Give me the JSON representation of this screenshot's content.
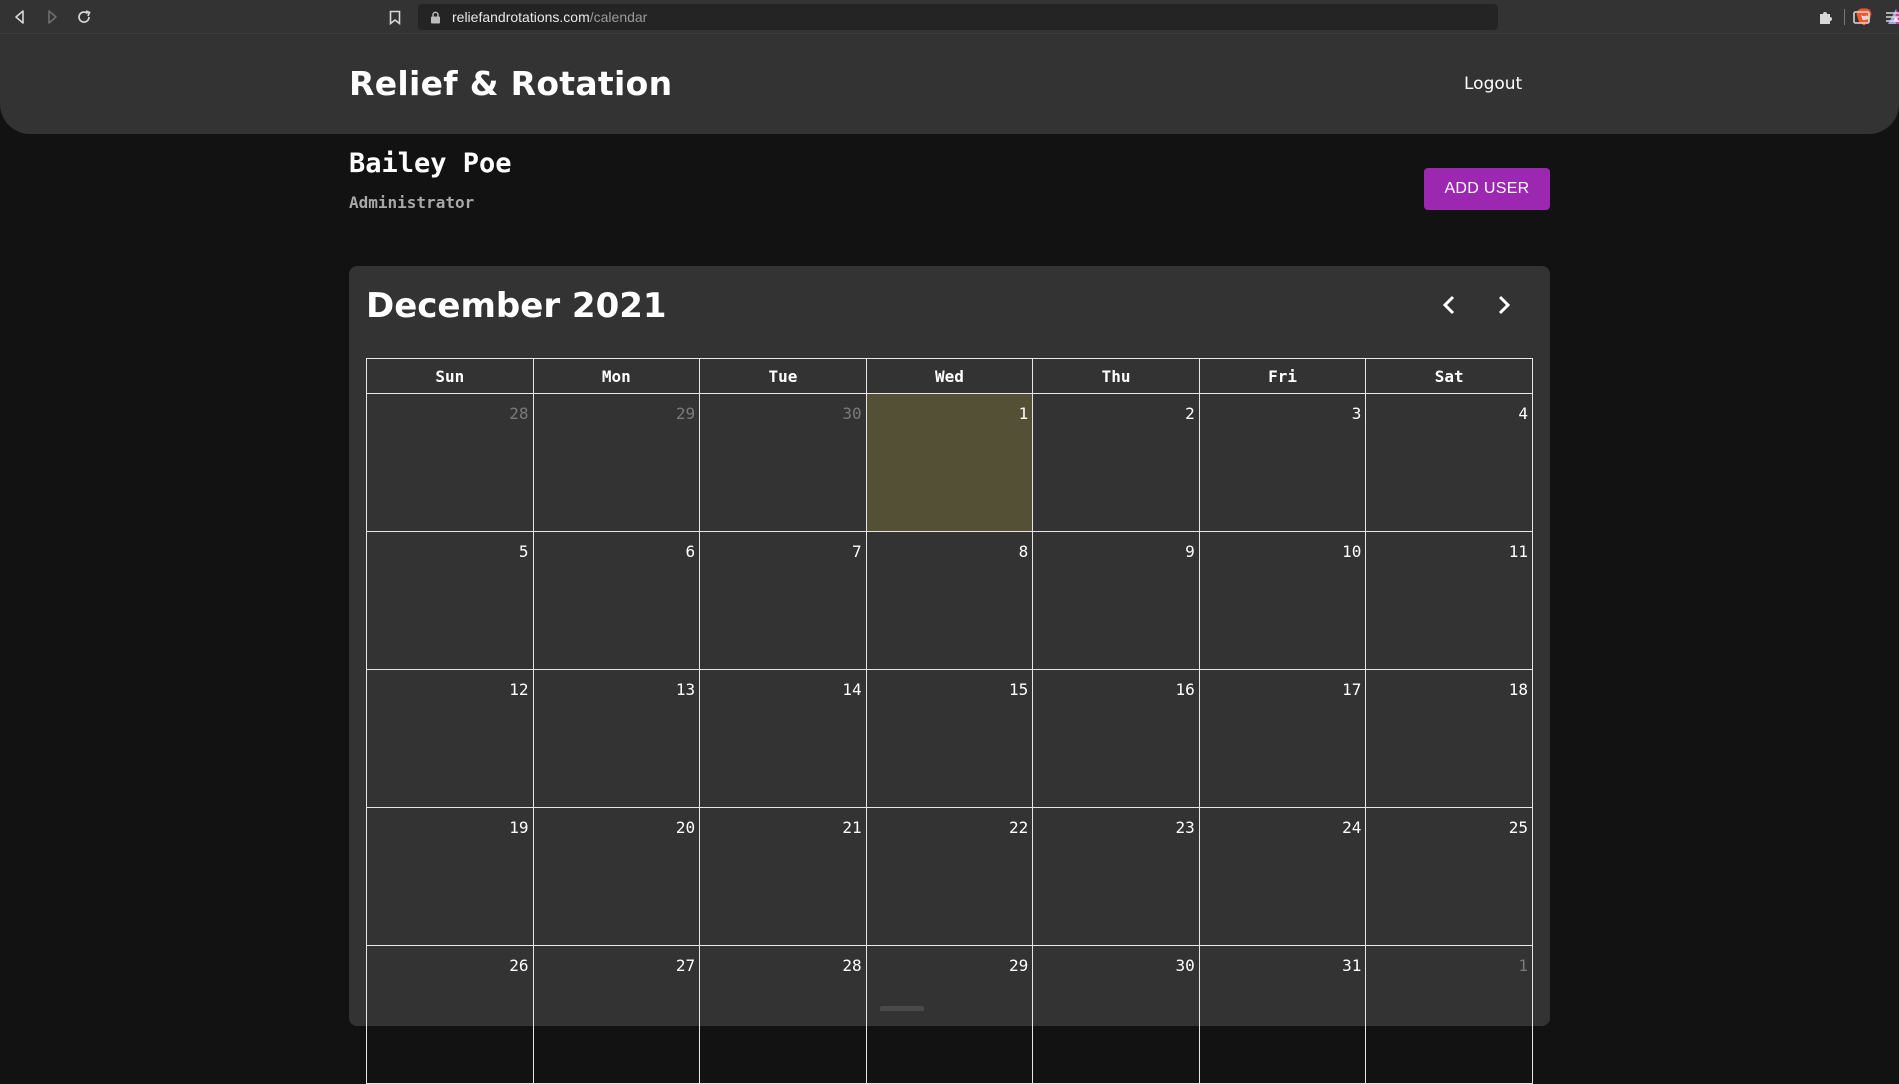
{
  "browser": {
    "url_host": "reliefandrotations.com",
    "url_path": "/calendar"
  },
  "header": {
    "brand": "Relief & Rotation",
    "logout_label": "Logout"
  },
  "user": {
    "name": "Bailey Poe",
    "role": "Administrator",
    "add_user_label": "ADD USER"
  },
  "calendar": {
    "month_title": "December 2021",
    "weekdays": [
      "Sun",
      "Mon",
      "Tue",
      "Wed",
      "Thu",
      "Fri",
      "Sat"
    ],
    "weeks": [
      [
        {
          "day": "28",
          "other": true
        },
        {
          "day": "29",
          "other": true
        },
        {
          "day": "30",
          "other": true
        },
        {
          "day": "1",
          "today": true
        },
        {
          "day": "2"
        },
        {
          "day": "3"
        },
        {
          "day": "4"
        }
      ],
      [
        {
          "day": "5"
        },
        {
          "day": "6"
        },
        {
          "day": "7"
        },
        {
          "day": "8"
        },
        {
          "day": "9"
        },
        {
          "day": "10"
        },
        {
          "day": "11"
        }
      ],
      [
        {
          "day": "12"
        },
        {
          "day": "13"
        },
        {
          "day": "14"
        },
        {
          "day": "15"
        },
        {
          "day": "16"
        },
        {
          "day": "17"
        },
        {
          "day": "18"
        }
      ],
      [
        {
          "day": "19"
        },
        {
          "day": "20"
        },
        {
          "day": "21"
        },
        {
          "day": "22"
        },
        {
          "day": "23"
        },
        {
          "day": "24"
        },
        {
          "day": "25"
        }
      ],
      [
        {
          "day": "26"
        },
        {
          "day": "27"
        },
        {
          "day": "28"
        },
        {
          "day": "29"
        },
        {
          "day": "30"
        },
        {
          "day": "31"
        },
        {
          "day": "1",
          "other": true
        }
      ]
    ]
  },
  "colors": {
    "accent": "#9c27b0",
    "today_highlight": "#545035",
    "surface": "#333333",
    "background": "#121212"
  },
  "icons": {
    "back": "arrow-left-icon",
    "forward": "arrow-right-icon",
    "reload": "reload-icon",
    "bookmark": "bookmark-icon",
    "lock": "lock-icon",
    "brave": "brave-shield-icon",
    "rewards": "brave-rewards-icon",
    "extensions": "puzzle-icon",
    "wallet": "wallet-icon",
    "menu": "menu-icon",
    "prev_month": "chevron-left-icon",
    "next_month": "chevron-right-icon"
  }
}
